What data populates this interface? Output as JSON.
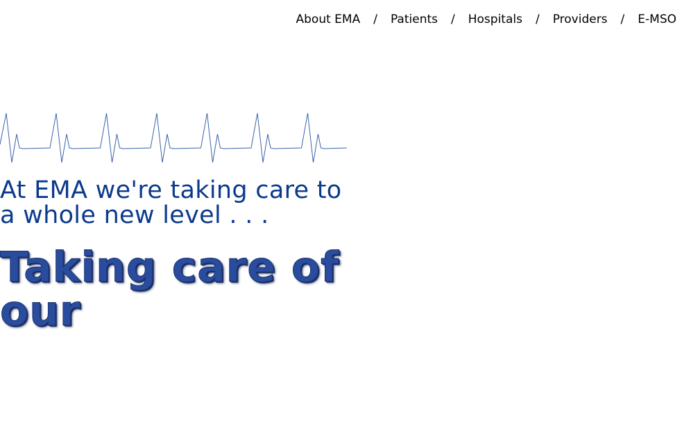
{
  "nav": {
    "items": [
      {
        "label": "About EMA"
      },
      {
        "label": "Patients"
      },
      {
        "label": "Hospitals"
      },
      {
        "label": "Providers"
      },
      {
        "label": "E-MSO"
      }
    ],
    "separator": "/"
  },
  "hero": {
    "tagline": "At EMA we're taking care to a whole new level . . .",
    "headline": "Taking care of our"
  },
  "colors": {
    "nav_text": "#000000",
    "tagline": "#0b3a8c",
    "headline": "#2a4c9e",
    "heartbeat_line": "#3a62a8",
    "background": "#ffffff"
  },
  "icons": {
    "heartbeat": "ecg-line-icon"
  }
}
